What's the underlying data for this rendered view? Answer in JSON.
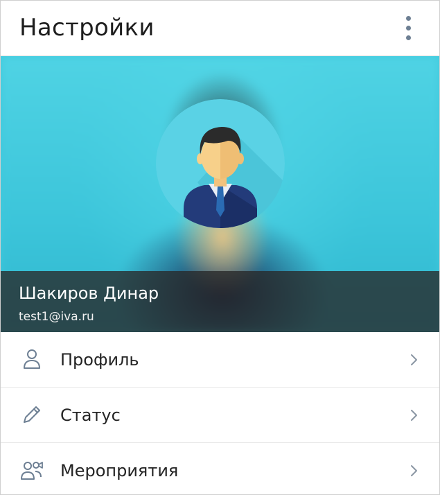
{
  "header": {
    "title": "Настройки",
    "more_icon": "more-vertical-icon"
  },
  "profile": {
    "name": "Шакиров Динар",
    "email": "test1@iva.ru",
    "avatar_icon": "user-avatar-icon"
  },
  "menu": {
    "items": [
      {
        "label": "Профиль",
        "icon": "user-icon"
      },
      {
        "label": "Статус",
        "icon": "pencil-icon"
      },
      {
        "label": "Мероприятия",
        "icon": "events-icon"
      }
    ],
    "chevron_icon": "chevron-right-icon"
  },
  "colors": {
    "accent_icon": "#6d7f93",
    "avatar_bg": "#5ad2e5",
    "userbar_bg": "#2a2a2a"
  }
}
